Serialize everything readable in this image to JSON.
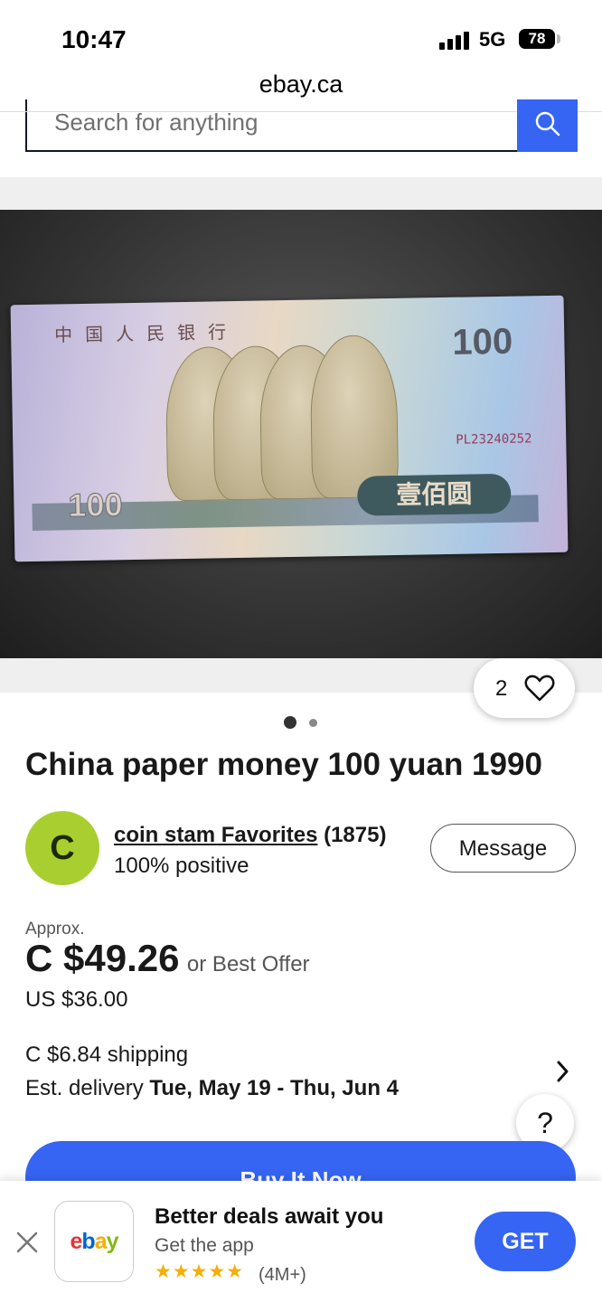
{
  "status_bar": {
    "time": "10:47",
    "network": "5G",
    "battery": "78"
  },
  "browser": {
    "url": "ebay.ca"
  },
  "search": {
    "placeholder": "Search for anything",
    "icon": "search-icon"
  },
  "listing": {
    "image_alt": "China paper money 100 yuan 1990",
    "image_index": 1,
    "image_count": 2,
    "watch_count": "2",
    "title": "China paper money 100 yuan 1990",
    "banknote": {
      "top_text": "中国人民银行",
      "denomination": "100",
      "serial": "PL23240252",
      "chars": "壹佰圆"
    }
  },
  "seller": {
    "avatar_letter": "C",
    "name": "coin stam Favorites",
    "score": "(1875)",
    "feedback": "100% positive",
    "message_label": "Message"
  },
  "price": {
    "approx_label": "Approx.",
    "price_cad": "C $49.26",
    "best_offer": "or Best Offer",
    "price_usd": "US $36.00"
  },
  "shipping": {
    "cost": "C $6.84 shipping",
    "delivery_label": "Est. delivery",
    "delivery_dates": "Tue, May 19 - Thu, Jun 4"
  },
  "actions": {
    "help_label": "?",
    "buy_now_label": "Buy It Now"
  },
  "app_banner": {
    "title": "Better deals await you",
    "subtitle": "Get the app",
    "stars": "★★★★★",
    "rating_count": "(4M+)",
    "get_label": "GET",
    "logo": {
      "e": "e",
      "b": "b",
      "a": "a",
      "y": "y"
    }
  },
  "colors": {
    "accent": "#3665f3",
    "avatar": "#a8cf2f",
    "star": "#f5af02"
  }
}
